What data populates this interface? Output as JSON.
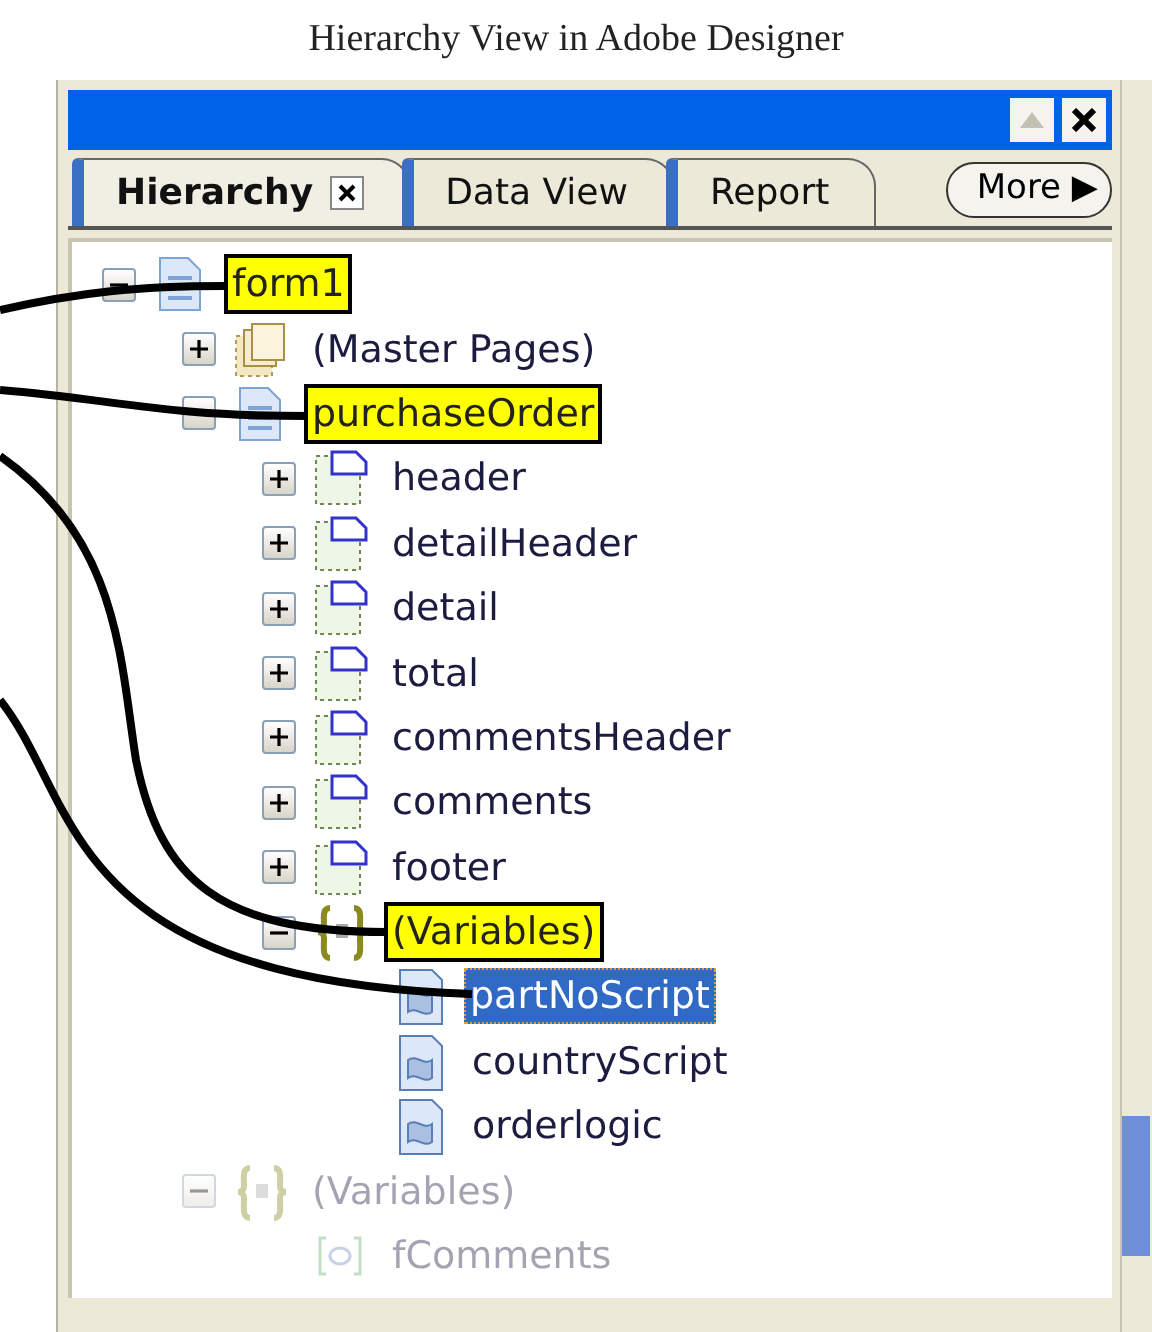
{
  "caption": "Hierarchy View in Adobe Designer",
  "panel": {
    "buttons": [
      {
        "kind": "up",
        "disabled": true
      },
      {
        "kind": "close",
        "disabled": false
      }
    ],
    "tabs": [
      {
        "label": "Hierarchy",
        "selected": true,
        "closable": true
      },
      {
        "label": "Data View",
        "selected": false,
        "closable": false
      },
      {
        "label": "Report",
        "selected": false,
        "closable": false
      }
    ],
    "more_button": {
      "label": "More",
      "arrow": "▶"
    }
  },
  "tree": [
    {
      "label": "form1",
      "kind": "form",
      "expanded": true,
      "highlighted": true,
      "selected": false,
      "disabled": false,
      "children": [
        {
          "label": "(Master Pages)",
          "kind": "pages",
          "expanded": false,
          "highlighted": false,
          "selected": false,
          "disabled": false
        },
        {
          "label": "purchaseOrder",
          "kind": "form",
          "expanded": true,
          "highlighted": true,
          "selected": false,
          "disabled": false,
          "children": [
            {
              "label": "header",
              "kind": "subform",
              "expanded": false,
              "highlighted": false,
              "selected": false,
              "disabled": false
            },
            {
              "label": "detailHeader",
              "kind": "subform",
              "expanded": false,
              "highlighted": false,
              "selected": false,
              "disabled": false
            },
            {
              "label": "detail",
              "kind": "subform",
              "expanded": false,
              "highlighted": false,
              "selected": false,
              "disabled": false
            },
            {
              "label": "total",
              "kind": "subform",
              "expanded": false,
              "highlighted": false,
              "selected": false,
              "disabled": false
            },
            {
              "label": "commentsHeader",
              "kind": "subform",
              "expanded": false,
              "highlighted": false,
              "selected": false,
              "disabled": false
            },
            {
              "label": "comments",
              "kind": "subform",
              "expanded": false,
              "highlighted": false,
              "selected": false,
              "disabled": false
            },
            {
              "label": "footer",
              "kind": "subform",
              "expanded": false,
              "highlighted": false,
              "selected": false,
              "disabled": false
            },
            {
              "label": "(Variables)",
              "kind": "variables",
              "expanded": true,
              "highlighted": true,
              "selected": false,
              "disabled": false,
              "children": [
                {
                  "label": "partNoScript",
                  "kind": "script",
                  "highlighted": false,
                  "selected": true,
                  "disabled": false
                },
                {
                  "label": "countryScript",
                  "kind": "script",
                  "highlighted": false,
                  "selected": false,
                  "disabled": false
                },
                {
                  "label": "orderlogic",
                  "kind": "script",
                  "highlighted": false,
                  "selected": false,
                  "disabled": false
                }
              ]
            }
          ]
        },
        {
          "label": "(Variables)",
          "kind": "variables",
          "expanded": true,
          "highlighted": false,
          "selected": false,
          "disabled": true,
          "children": [
            {
              "label": "fComments",
              "kind": "variable",
              "highlighted": false,
              "selected": false,
              "disabled": true
            }
          ]
        }
      ]
    }
  ]
}
